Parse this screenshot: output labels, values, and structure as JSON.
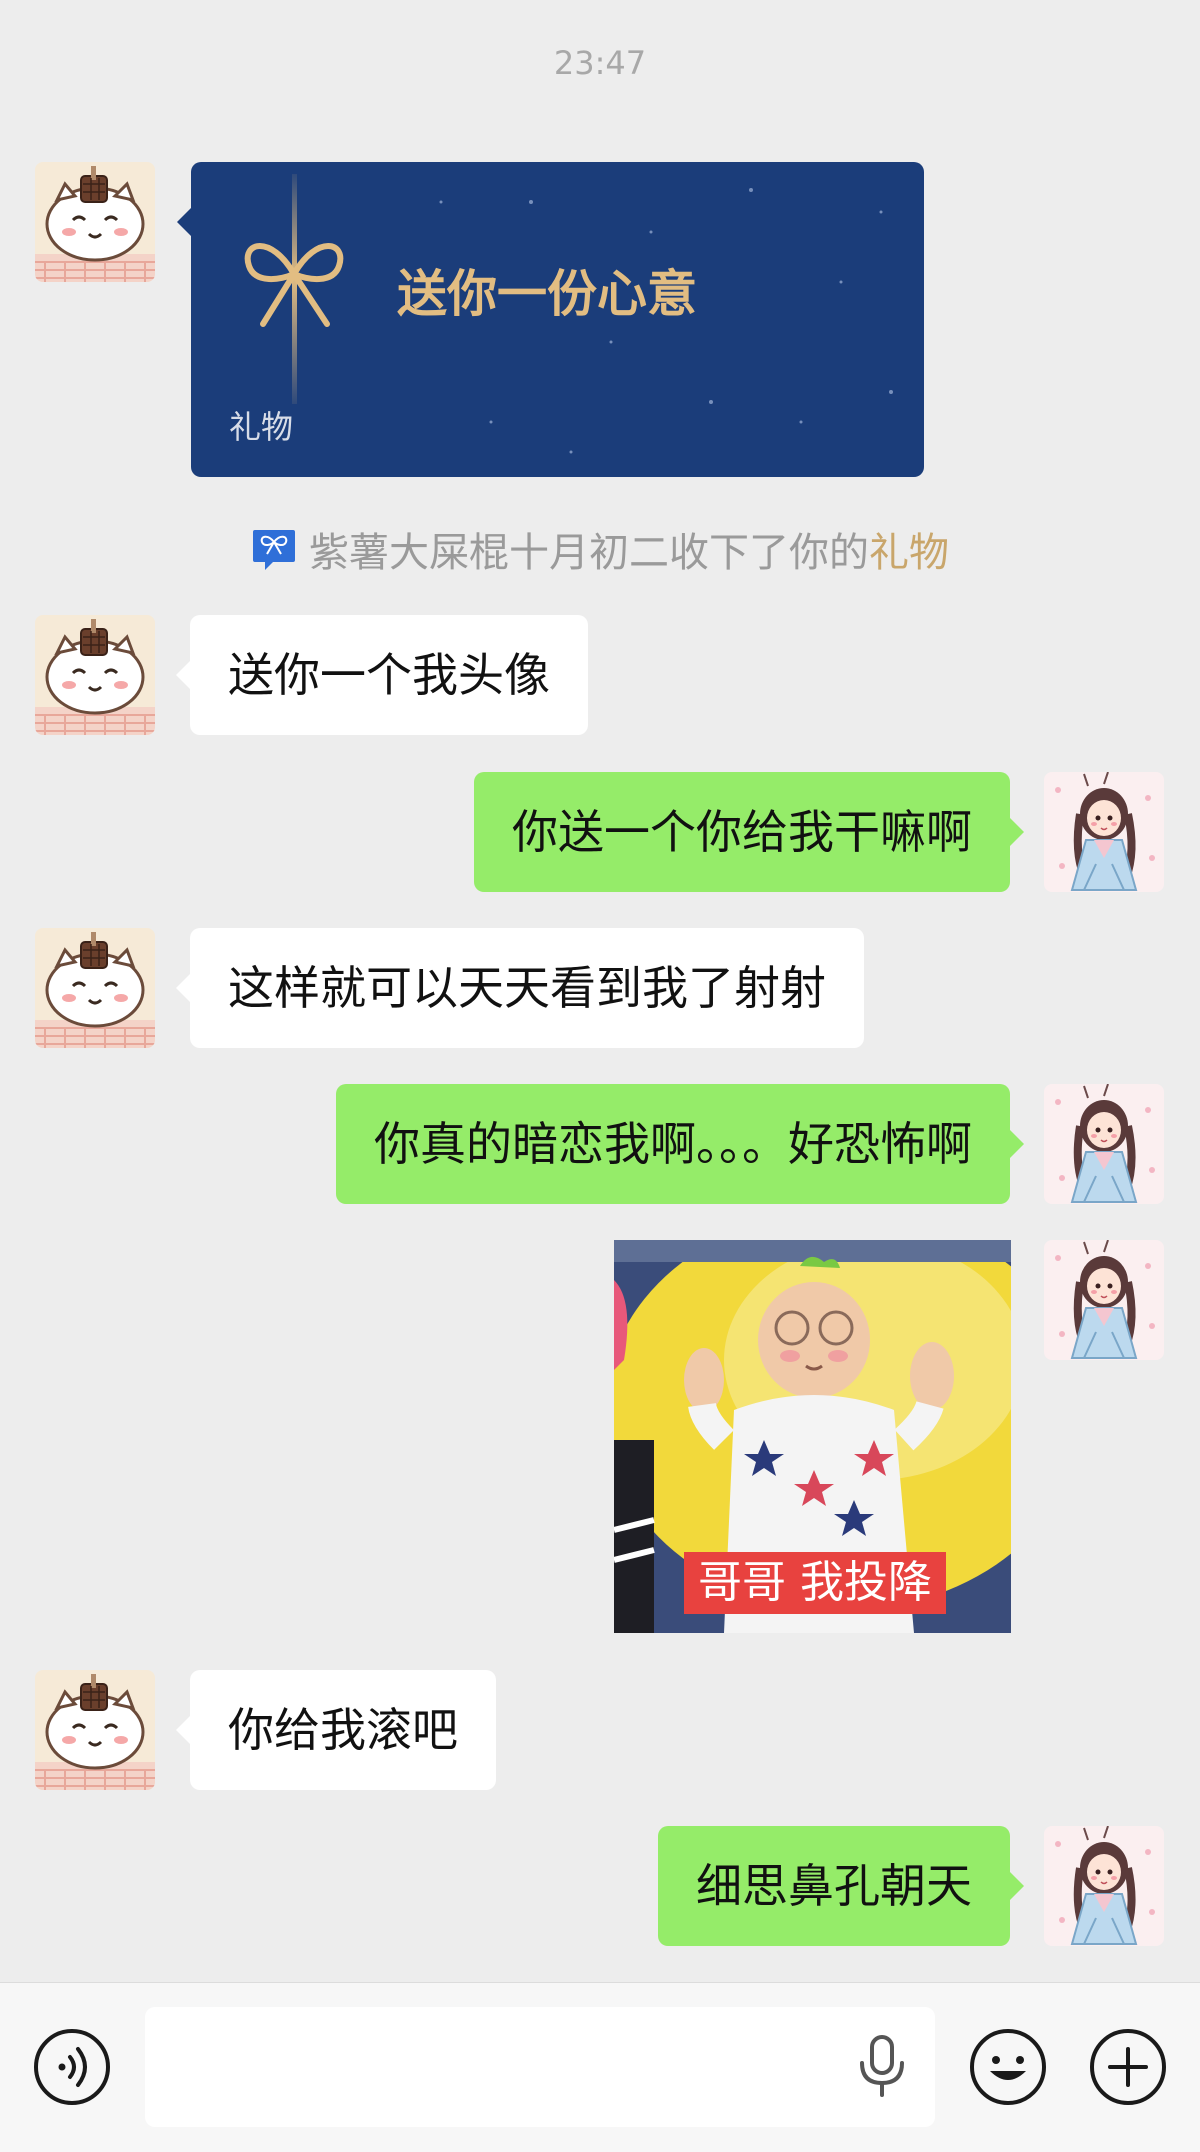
{
  "timestamp": "23:47",
  "gift_card": {
    "title": "送你一份心意",
    "label": "礼物",
    "bg_color": "#1b3d7a",
    "accent_color": "#e2bd82"
  },
  "system_notice": {
    "prefix": "紫薯大屎棍十月初二收下了你的",
    "highlight": "礼物",
    "icon": "gift-notice-icon"
  },
  "messages": [
    {
      "side": "left",
      "text": "送你一个我头像"
    },
    {
      "side": "right",
      "text": "你送一个你给我干嘛啊"
    },
    {
      "side": "left",
      "text": "这样就可以天天看到我了射射"
    },
    {
      "side": "right",
      "text": "你真的暗恋我啊。。。好恐怖啊"
    },
    {
      "side": "right",
      "type": "sticker",
      "caption": "哥哥 我投降"
    },
    {
      "side": "left",
      "text": "你给我滚吧"
    },
    {
      "side": "right",
      "text": "细思鼻孔朝天"
    }
  ],
  "input_bar": {
    "voice_icon": "voice-icon",
    "mic_icon": "mic-icon",
    "emoji_icon": "emoji-icon",
    "plus_icon": "plus-icon",
    "input_value": ""
  },
  "colors": {
    "background": "#ededed",
    "self_bubble": "#95ec69",
    "other_bubble": "#ffffff",
    "notice_highlight": "#c9a66b"
  }
}
